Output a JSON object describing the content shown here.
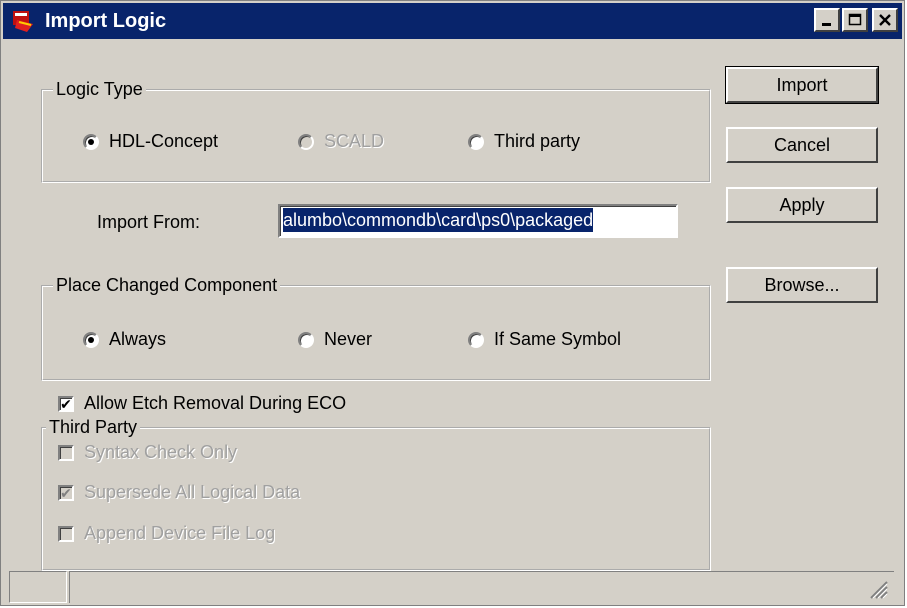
{
  "window": {
    "title": "Import Logic",
    "icon": "app-logo-icon"
  },
  "title_buttons": {
    "minimize": "minimize-icon",
    "maximize": "maximize-icon",
    "close": "close-icon"
  },
  "logic_type": {
    "legend": "Logic Type",
    "options": [
      {
        "label": "HDL-Concept",
        "checked": true,
        "enabled": true
      },
      {
        "label": "SCALD",
        "checked": false,
        "enabled": false
      },
      {
        "label": "Third party",
        "checked": false,
        "enabled": true
      }
    ]
  },
  "import_from": {
    "label": "Import From:",
    "value": "alumbo\\commondb\\card\\ps0\\packaged"
  },
  "place_changed": {
    "legend": "Place Changed Component",
    "options": [
      {
        "label": "Always",
        "checked": true
      },
      {
        "label": "Never",
        "checked": false
      },
      {
        "label": "If Same Symbol",
        "checked": false
      }
    ]
  },
  "allow_etch": {
    "label": "Allow Etch Removal During ECO",
    "checked": true
  },
  "third_party": {
    "legend": "Third Party",
    "options": [
      {
        "label": "Syntax Check Only",
        "checked": false,
        "enabled": false
      },
      {
        "label": "Supersede All Logical Data",
        "checked": true,
        "enabled": false
      },
      {
        "label": "Append Device File Log",
        "checked": false,
        "enabled": false
      }
    ]
  },
  "buttons": {
    "import": "Import",
    "cancel": "Cancel",
    "apply": "Apply",
    "browse": "Browse..."
  }
}
